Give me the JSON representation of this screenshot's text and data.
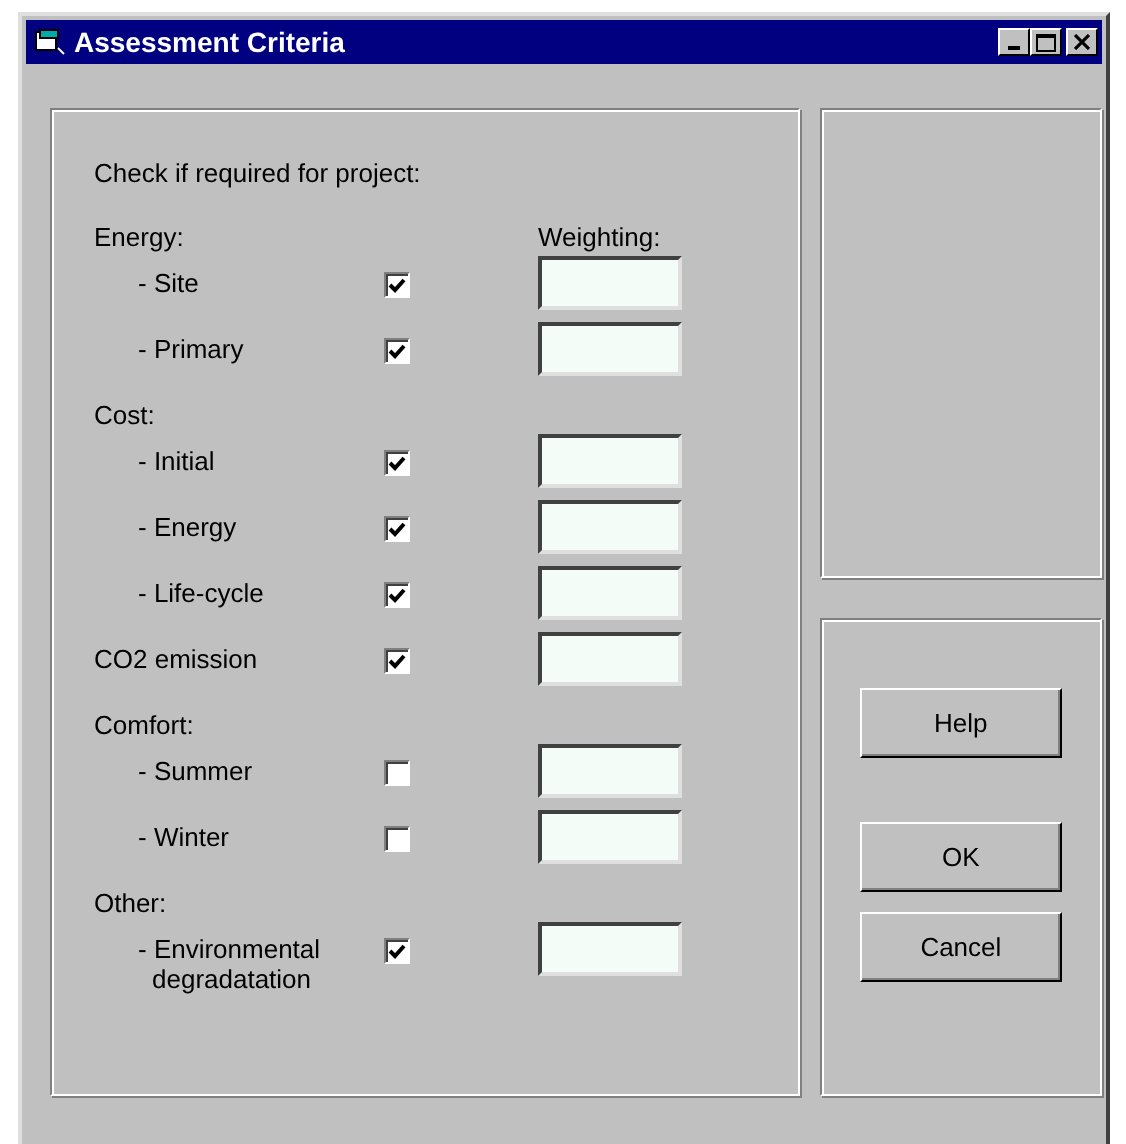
{
  "window": {
    "title": "Assessment Criteria"
  },
  "criteria": {
    "prompt": "Check if required for project:",
    "weighting_label": "Weighting:",
    "rows": [
      {
        "kind": "heading",
        "label": "Energy:"
      },
      {
        "kind": "item",
        "label": "- Site",
        "checked": true
      },
      {
        "kind": "item",
        "label": "- Primary",
        "checked": true
      },
      {
        "kind": "heading",
        "label": "Cost:"
      },
      {
        "kind": "item",
        "label": "- Initial",
        "checked": true
      },
      {
        "kind": "item",
        "label": "- Energy",
        "checked": true
      },
      {
        "kind": "item",
        "label": "- Life-cycle",
        "checked": true
      },
      {
        "kind": "top-item",
        "label": "CO2 emission",
        "checked": true
      },
      {
        "kind": "heading",
        "label": "Comfort:"
      },
      {
        "kind": "item",
        "label": "- Summer",
        "checked": false
      },
      {
        "kind": "item",
        "label": "- Winter",
        "checked": false
      },
      {
        "kind": "heading",
        "label": "Other:"
      },
      {
        "kind": "item",
        "label": "- Environmental degradatation",
        "checked": true
      }
    ]
  },
  "buttons": [
    {
      "label": "Help",
      "kind": "help"
    },
    {
      "label": "OK",
      "kind": "action"
    },
    {
      "label": "Cancel",
      "kind": "action"
    }
  ]
}
